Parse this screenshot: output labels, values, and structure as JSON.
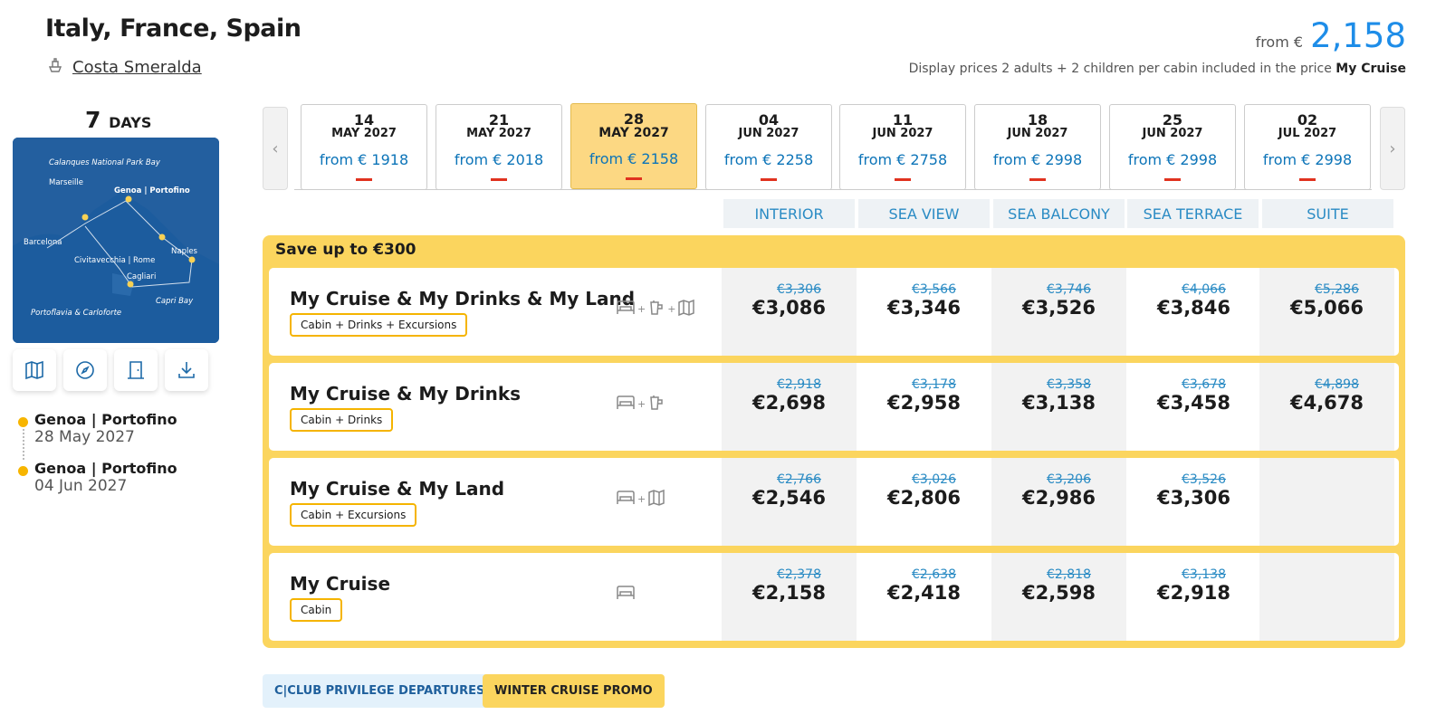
{
  "header": {
    "title": "Italy, France, Spain",
    "ship": "Costa Smeralda",
    "price_from_label": "from €",
    "price_from_value": "2,158",
    "display_note_prefix": "Display prices 2 adults + 2 children per cabin included in the price",
    "display_note_package": "My Cruise"
  },
  "left": {
    "days_number": "7",
    "days_label": "DAYS",
    "map_labels": [
      "Calanques National Park Bay",
      "Marseille",
      "Genoa | Portofino",
      "Barcelona",
      "Naples",
      "Civitavecchia | Rome",
      "Cagliari",
      "Capri Bay",
      "Portoflavia & Carloforte"
    ],
    "icons": [
      "map-icon",
      "compass-icon",
      "door-icon",
      "download-icon"
    ],
    "itinerary": [
      {
        "port": "Genoa | Portofino",
        "date": "28 May 2027"
      },
      {
        "port": "Genoa | Portofino",
        "date": "04 Jun 2027"
      }
    ]
  },
  "dates": [
    {
      "day": "14",
      "month": "MAY 2027",
      "price": "from € 1918"
    },
    {
      "day": "21",
      "month": "MAY 2027",
      "price": "from € 2018"
    },
    {
      "day": "28",
      "month": "MAY 2027",
      "price": "from € 2158",
      "selected": true
    },
    {
      "day": "04",
      "month": "JUN 2027",
      "price": "from € 2258"
    },
    {
      "day": "11",
      "month": "JUN 2027",
      "price": "from € 2758"
    },
    {
      "day": "18",
      "month": "JUN 2027",
      "price": "from € 2998"
    },
    {
      "day": "25",
      "month": "JUN 2027",
      "price": "from € 2998"
    },
    {
      "day": "02",
      "month": "JUL 2027",
      "price": "from € 2998"
    }
  ],
  "cabins": [
    "INTERIOR",
    "SEA VIEW",
    "SEA BALCONY",
    "SEA TERRACE",
    "SUITE"
  ],
  "promo": {
    "title": "Save up to €300",
    "packages": [
      {
        "name": "My Cruise & My Drinks & My Land",
        "tag": "Cabin + Drinks + Excursions",
        "icons": [
          "bed-icon",
          "drink-icon",
          "map-icon"
        ],
        "prices": [
          {
            "old": "€3,306",
            "new": "€3,086"
          },
          {
            "old": "€3,566",
            "new": "€3,346"
          },
          {
            "old": "€3,746",
            "new": "€3,526"
          },
          {
            "old": "€4,066",
            "new": "€3,846"
          },
          {
            "old": "€5,286",
            "new": "€5,066"
          }
        ]
      },
      {
        "name": "My Cruise & My Drinks",
        "tag": "Cabin + Drinks",
        "icons": [
          "bed-icon",
          "drink-icon"
        ],
        "prices": [
          {
            "old": "€2,918",
            "new": "€2,698"
          },
          {
            "old": "€3,178",
            "new": "€2,958"
          },
          {
            "old": "€3,358",
            "new": "€3,138"
          },
          {
            "old": "€3,678",
            "new": "€3,458"
          },
          {
            "old": "€4,898",
            "new": "€4,678"
          }
        ]
      },
      {
        "name": "My Cruise & My Land",
        "tag": "Cabin + Excursions",
        "icons": [
          "bed-icon",
          "map-icon"
        ],
        "prices": [
          {
            "old": "€2,766",
            "new": "€2,546"
          },
          {
            "old": "€3,026",
            "new": "€2,806"
          },
          {
            "old": "€3,206",
            "new": "€2,986"
          },
          {
            "old": "€3,526",
            "new": "€3,306"
          },
          {
            "old": "",
            "new": ""
          }
        ]
      },
      {
        "name": "My Cruise",
        "tag": "Cabin",
        "icons": [
          "bed-icon"
        ],
        "prices": [
          {
            "old": "€2,378",
            "new": "€2,158"
          },
          {
            "old": "€2,638",
            "new": "€2,418"
          },
          {
            "old": "€2,818",
            "new": "€2,598"
          },
          {
            "old": "€3,138",
            "new": "€2,918"
          },
          {
            "old": "",
            "new": ""
          }
        ]
      }
    ]
  },
  "badges": [
    "C|CLUB PRIVILEGE DEPARTURES",
    "WINTER CRUISE PROMO"
  ],
  "colors": {
    "accent_blue": "#1e8de8",
    "promo_yellow": "#fbd55e",
    "selected_date": "#fcd883"
  }
}
